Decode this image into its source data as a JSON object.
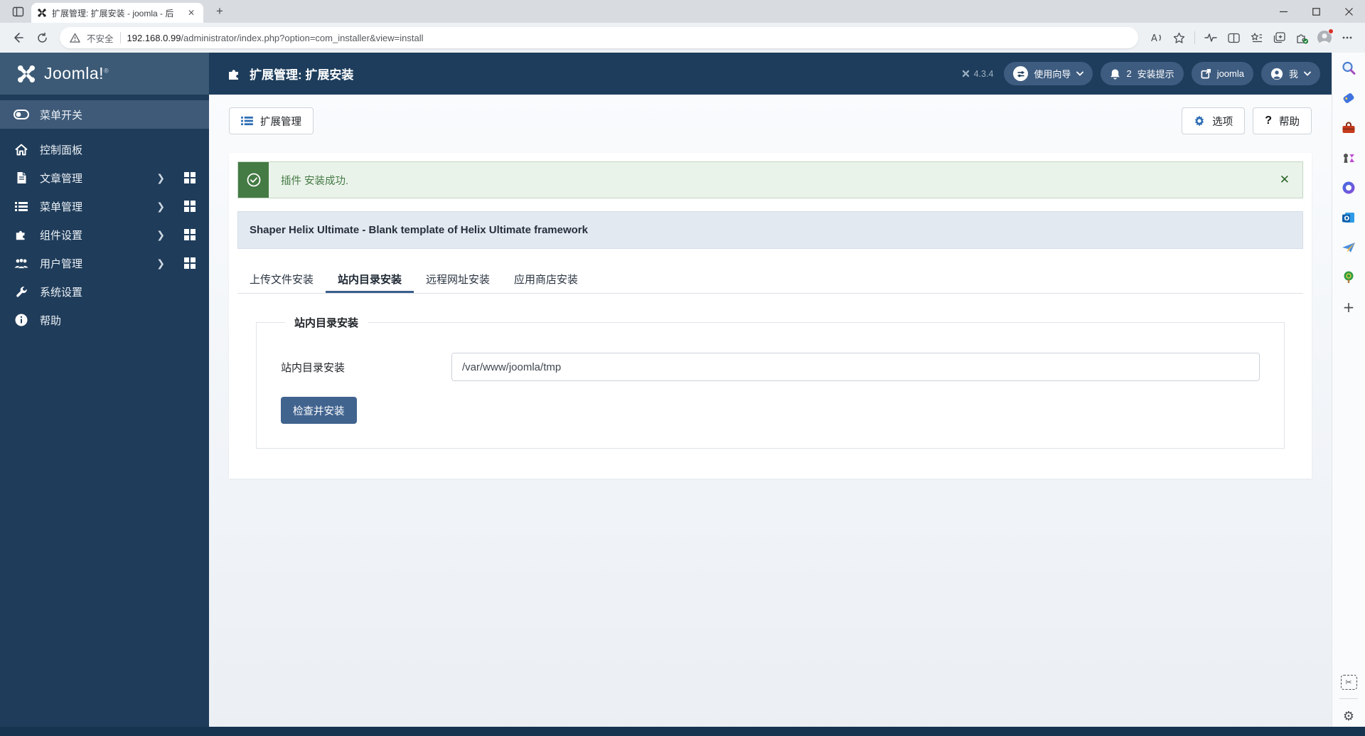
{
  "browser": {
    "tab": {
      "title": "扩展管理: 扩展安装 - joomla - 后",
      "close_label": "✕",
      "new_tab_label": "+"
    },
    "urlbar": {
      "security_label": "不安全",
      "url_domain": "192.168.0.99",
      "url_path": "/administrator/index.php?option=com_installer&view=install"
    }
  },
  "header": {
    "logo_text": "Joomla!",
    "logo_reg": "®",
    "page_title": "扩展管理: 扩展安装",
    "version": "4.3.4",
    "notifications_count": "2",
    "pills": {
      "wizard": "使用向导",
      "notices": "安装提示",
      "site": "joomla",
      "me": "我"
    }
  },
  "sidebar": {
    "items": [
      {
        "label": "菜单开关"
      },
      {
        "label": "控制面板"
      },
      {
        "label": "文章管理"
      },
      {
        "label": "菜单管理"
      },
      {
        "label": "组件设置"
      },
      {
        "label": "用户管理"
      },
      {
        "label": "系统设置"
      },
      {
        "label": "帮助"
      }
    ]
  },
  "toolbar": {
    "back_label": "扩展管理",
    "options_label": "选项",
    "help_label": "帮助"
  },
  "main": {
    "alert_text": "插件 安装成功.",
    "template_heading": "Shaper Helix Ultimate - Blank template of Helix Ultimate framework",
    "tabs": [
      {
        "label": "上传文件安装"
      },
      {
        "label": "站内目录安装"
      },
      {
        "label": "远程网址安装"
      },
      {
        "label": "应用商店安装"
      }
    ],
    "form": {
      "legend": "站内目录安装",
      "label": "站内目录安装",
      "value": "/var/www/joomla/tmp",
      "button_label": "检查并安装"
    }
  },
  "edge_sidebar": {
    "icons": [
      "search",
      "shopping",
      "toolbox",
      "games",
      "microsoft-365",
      "outlook",
      "drop",
      "tree",
      "add"
    ],
    "bottom_icons": [
      "screenshot",
      "settings"
    ]
  },
  "colors": {
    "header_dark": "#1e3d5c",
    "header_light": "#3c5a76",
    "sidebar": "#1f3c5a",
    "active_item": "#3e5a78",
    "success_green": "#447a44",
    "primary_button": "#41648f",
    "accent_blue": "#2e6db4"
  }
}
